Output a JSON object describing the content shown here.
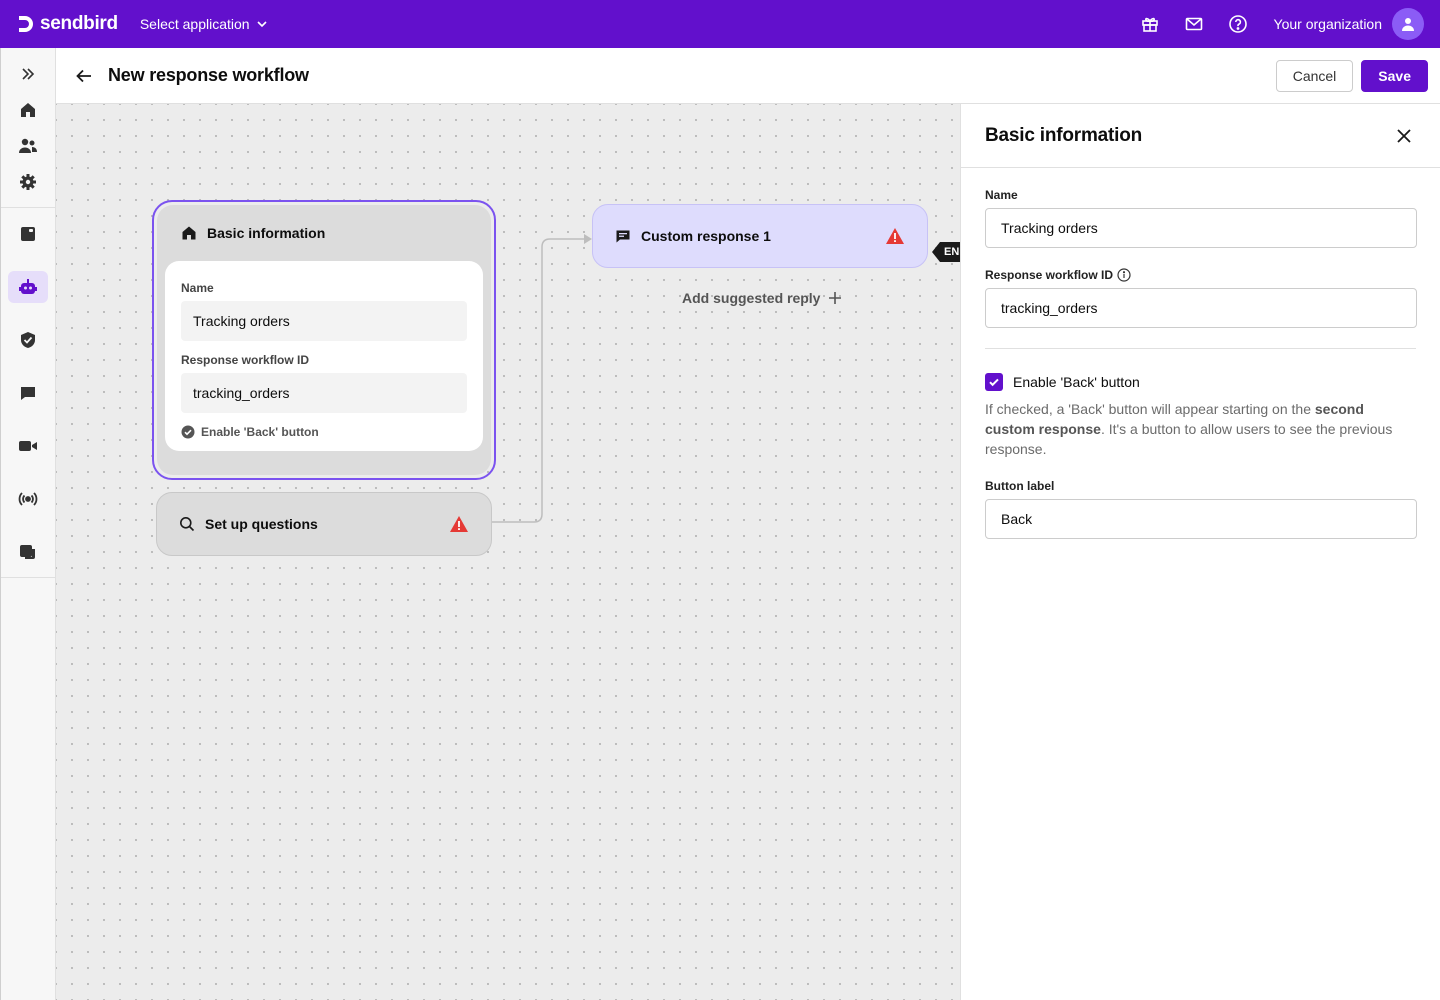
{
  "topbar": {
    "brand": "sendbird",
    "app_select": "Select application",
    "org_name": "Your organization",
    "icons": [
      "gift-icon",
      "mail-icon",
      "help-icon"
    ]
  },
  "sidebar": {
    "items": [
      "expand",
      "home",
      "users",
      "settings",
      "chat-docs",
      "bot",
      "moderation",
      "desk",
      "calls",
      "live",
      "notifications"
    ],
    "active": "bot"
  },
  "header": {
    "title": "New response workflow",
    "cancel": "Cancel",
    "save": "Save"
  },
  "canvas": {
    "basic_node": {
      "title": "Basic information",
      "name_label": "Name",
      "name_value": "Tracking orders",
      "id_label": "Response workflow ID",
      "id_value": "tracking_orders",
      "back_label": "Enable 'Back' button"
    },
    "questions_node": {
      "title": "Set up questions"
    },
    "custom_node": {
      "title": "Custom response 1"
    },
    "add_reply": "Add suggested reply",
    "end_tag": "END"
  },
  "panel": {
    "title": "Basic information",
    "name_label": "Name",
    "name_value": "Tracking orders",
    "id_label": "Response workflow ID",
    "id_value": "tracking_orders",
    "back_checkbox_label": "Enable 'Back' button",
    "back_checked": true,
    "desc_1": "If checked, a 'Back' button will appear starting on the ",
    "desc_bold": "second custom response",
    "desc_2": ". It's a button to allow users to see the previous response.",
    "button_label_label": "Button label",
    "button_label_value": "Back"
  },
  "colors": {
    "brand": "#6210cc",
    "selected_border": "#7b53ef",
    "custom_node_bg": "#dedcfd",
    "warning": "#e53935"
  }
}
